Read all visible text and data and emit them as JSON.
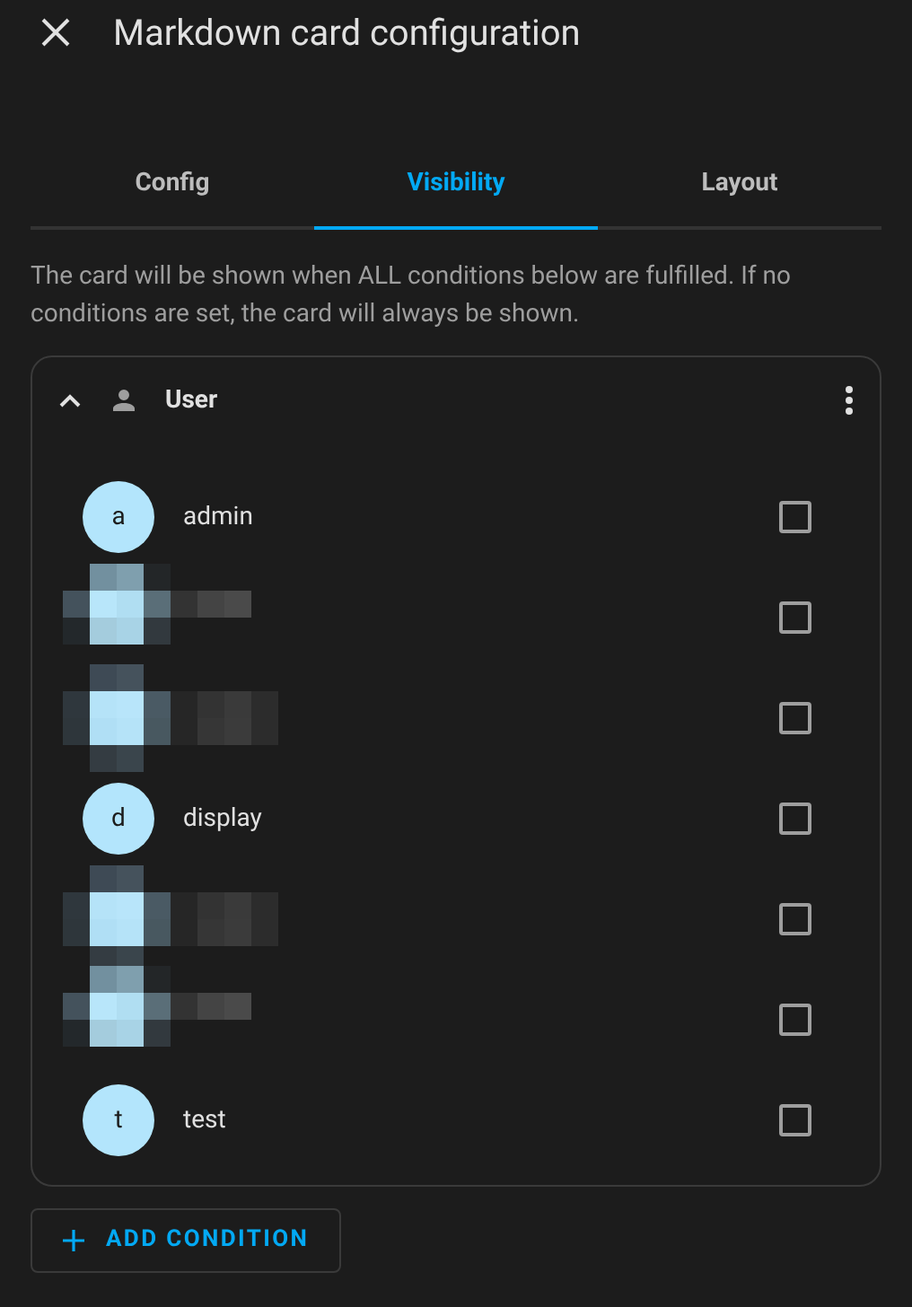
{
  "dialog": {
    "title": "Markdown card configuration"
  },
  "tabs": [
    {
      "label": "Config",
      "selected": false
    },
    {
      "label": "Visibility",
      "selected": true
    },
    {
      "label": "Layout",
      "selected": false
    }
  ],
  "description": "The card will be shown when ALL conditions below are fulfilled. If no conditions are set, the card will always be shown.",
  "condition": {
    "title": "User",
    "expanded": true,
    "users": [
      {
        "kind": "user",
        "initial": "a",
        "name": "admin",
        "checked": false
      },
      {
        "kind": "redacted",
        "checked": false
      },
      {
        "kind": "redacted",
        "checked": false
      },
      {
        "kind": "user",
        "initial": "d",
        "name": "display",
        "checked": false
      },
      {
        "kind": "redacted",
        "checked": false
      },
      {
        "kind": "redacted",
        "checked": false
      },
      {
        "kind": "user",
        "initial": "t",
        "name": "test",
        "checked": false
      }
    ]
  },
  "add_button": {
    "label": "ADD CONDITION"
  }
}
